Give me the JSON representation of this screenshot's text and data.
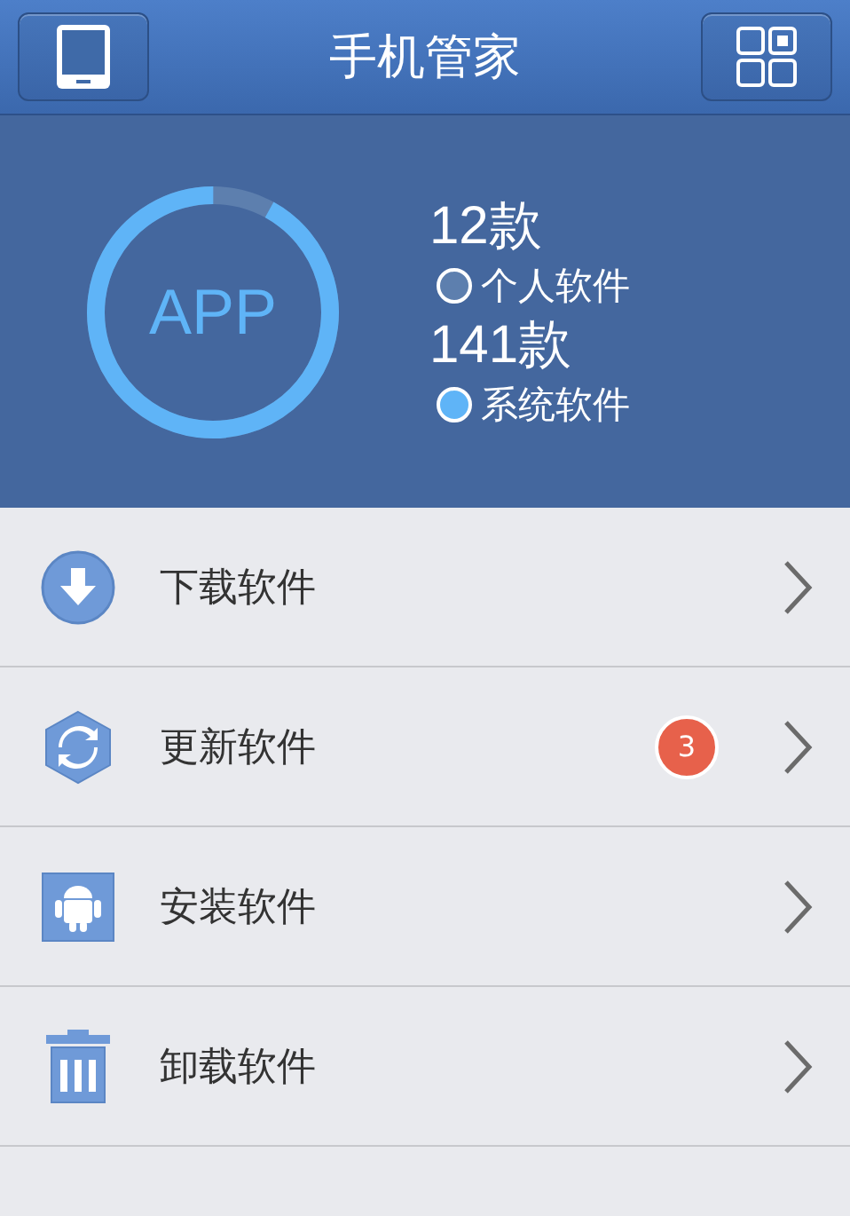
{
  "header": {
    "title": "手机管家"
  },
  "summary": {
    "ring_label": "APP",
    "groups": [
      {
        "count": "12款",
        "label": "个人软件",
        "color": "#5d7fae"
      },
      {
        "count": "141款",
        "label": "系统软件",
        "color": "#5fb4f7"
      }
    ]
  },
  "menu": [
    {
      "kind": "download",
      "label": "下载软件"
    },
    {
      "kind": "update",
      "label": "更新软件",
      "badge": "3"
    },
    {
      "kind": "install",
      "label": "安装软件"
    },
    {
      "kind": "uninstall",
      "label": "卸载软件"
    }
  ]
}
